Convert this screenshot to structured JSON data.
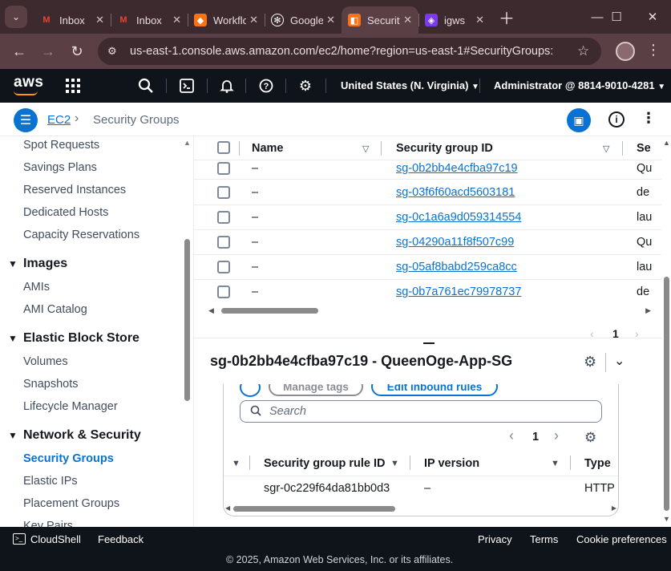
{
  "browser": {
    "tabs": [
      {
        "title": "Inbox",
        "icon": "gmail-icon"
      },
      {
        "title": "Inbox",
        "icon": "gmail-icon"
      },
      {
        "title": "Workflows",
        "icon": "workflow-icon"
      },
      {
        "title": "Google",
        "icon": "openai-icon"
      },
      {
        "title": "Security Groups",
        "icon": "aws-console-icon",
        "active": true
      },
      {
        "title": "igws",
        "icon": "extension-icon"
      }
    ],
    "url": "us-east-1.console.aws.amazon.com/ec2/home?region=us-east-1#SecurityGroups:"
  },
  "aws_nav": {
    "logo": "aws",
    "region": "United States (N. Virginia)",
    "account": "Administrator @ 8814-9010-4281"
  },
  "breadcrumb": {
    "service": "EC2",
    "current": "Security Groups"
  },
  "sidebar": {
    "items_top": [
      "Spot Requests",
      "Savings Plans",
      "Reserved Instances",
      "Dedicated Hosts",
      "Capacity Reservations"
    ],
    "images": {
      "title": "Images",
      "items": [
        "AMIs",
        "AMI Catalog"
      ]
    },
    "ebs": {
      "title": "Elastic Block Store",
      "items": [
        "Volumes",
        "Snapshots",
        "Lifecycle Manager"
      ]
    },
    "network": {
      "title": "Network & Security",
      "items": [
        "Security Groups",
        "Elastic IPs",
        "Placement Groups",
        "Key Pairs"
      ]
    }
  },
  "table": {
    "columns": [
      "Name",
      "Security group ID",
      "Se"
    ],
    "rows": [
      {
        "name": "–",
        "id": "sg-0b2bb4e4cfba97c19",
        "desc": "Qu"
      },
      {
        "name": "–",
        "id": "sg-03f6f60acd5603181",
        "desc": "de"
      },
      {
        "name": "–",
        "id": "sg-0c1a6a9d059314554",
        "desc": "lau"
      },
      {
        "name": "–",
        "id": "sg-04290a11f8f507c99",
        "desc": "Qu"
      },
      {
        "name": "–",
        "id": "sg-05af8babd259ca8cc",
        "desc": "lau"
      },
      {
        "name": "–",
        "id": "sg-0b7a761ec79978737",
        "desc": "de"
      }
    ],
    "page": "1"
  },
  "detail": {
    "title": "sg-0b2bb4e4cfba97c19 - QueenOge-App-SG",
    "manage_tags": "Manage tags",
    "edit_inbound": "Edit inbound rules",
    "search_placeholder": "Search",
    "page": "1",
    "rule_columns": [
      "Security group rule ID",
      "IP version",
      "Type"
    ],
    "rules": [
      {
        "id": "sgr-0c229f64da81bb0d3",
        "ip_version": "–",
        "type": "HTTP"
      }
    ]
  },
  "footer": {
    "cloudshell": "CloudShell",
    "feedback": "Feedback",
    "privacy": "Privacy",
    "terms": "Terms",
    "cookies": "Cookie preferences",
    "copyright": "© 2025, Amazon Web Services, Inc. or its affiliates."
  },
  "colors": {
    "accent": "#0972d3",
    "nav_bg": "#0f141a",
    "chrome_bg": "#3c2a2e"
  }
}
